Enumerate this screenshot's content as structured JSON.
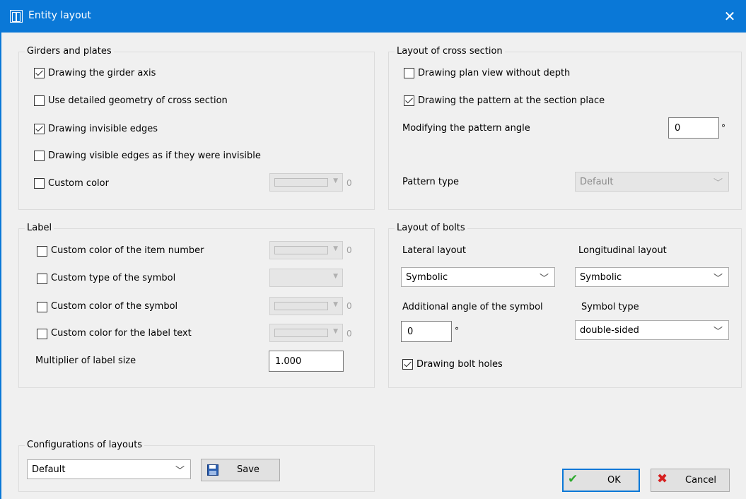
{
  "window": {
    "title": "Entity layout",
    "close_glyph": "✕"
  },
  "girders": {
    "title": "Girders and plates",
    "items": [
      {
        "label": "Drawing the girder axis",
        "checked": true
      },
      {
        "label": "Use detailed geometry of cross section",
        "checked": false
      },
      {
        "label": "Drawing invisible edges",
        "checked": true
      },
      {
        "label": "Drawing visible edges as if they were invisible",
        "checked": false
      },
      {
        "label": "Custom color",
        "checked": false
      }
    ],
    "custom_color_index": "0"
  },
  "label": {
    "title": "Label",
    "items": [
      {
        "label": "Custom color of the item number",
        "checked": false,
        "index": "0"
      },
      {
        "label": "Custom type of the symbol",
        "checked": false
      },
      {
        "label": "Custom color of the symbol",
        "checked": false,
        "index": "0"
      },
      {
        "label": "Custom color for the label text",
        "checked": false,
        "index": "0"
      }
    ],
    "multiplier_label": "Multiplier of label size",
    "multiplier_value": "1.000"
  },
  "cross_section": {
    "title": "Layout of cross section",
    "plan_view": {
      "label": "Drawing plan view without depth",
      "checked": false
    },
    "pattern": {
      "label": "Drawing the pattern at the section place",
      "checked": true
    },
    "angle_label": "Modifying the pattern angle",
    "angle_value": "0",
    "angle_unit": "°",
    "pattern_type_label": "Pattern type",
    "pattern_type_value": "Default"
  },
  "bolts": {
    "title": "Layout of bolts",
    "lateral_label": "Lateral layout",
    "lateral_value": "Symbolic",
    "longitudinal_label": "Longitudinal layout",
    "longitudinal_value": "Symbolic",
    "angle_label": "Additional angle of the symbol",
    "angle_value": "0",
    "angle_unit": "°",
    "symbol_type_label": "Symbol type",
    "symbol_type_value": "double-sided",
    "holes": {
      "label": "Drawing bolt holes",
      "checked": true
    }
  },
  "configurations": {
    "title": "Configurations of layouts",
    "selected": "Default",
    "save_label": "Save"
  },
  "footer": {
    "ok_label": "OK",
    "cancel_label": "Cancel"
  },
  "colors": {
    "titlebar": "#0a78d7",
    "ok_check": "#2eaa2e",
    "cancel_x": "#d62020"
  }
}
